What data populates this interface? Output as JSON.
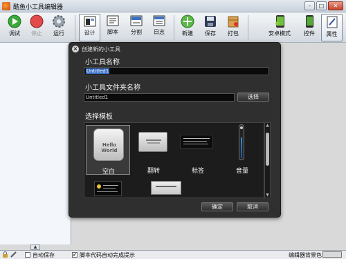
{
  "window": {
    "title": "酷鱼小工具编辑器"
  },
  "toolbar": {
    "items": [
      {
        "label": "调试",
        "icon": "play-icon"
      },
      {
        "label": "停止",
        "icon": "stop-icon"
      },
      {
        "label": "运行",
        "icon": "gear-icon"
      },
      {
        "label": "设计",
        "icon": "design-icon"
      },
      {
        "label": "脚本",
        "icon": "script-icon"
      },
      {
        "label": "分割",
        "icon": "split-icon"
      },
      {
        "label": "日志",
        "icon": "log-icon"
      },
      {
        "label": "新建",
        "icon": "new-icon"
      },
      {
        "label": "保存",
        "icon": "save-icon"
      },
      {
        "label": "打包",
        "icon": "package-icon"
      },
      {
        "label": "安卓模式",
        "icon": "android-icon"
      },
      {
        "label": "控件",
        "icon": "widgets-icon"
      },
      {
        "label": "属性",
        "icon": "properties-icon"
      }
    ],
    "selected": [
      "设计",
      "属性"
    ],
    "disabled": [
      "停止"
    ]
  },
  "dialog": {
    "title": "创建新的小工具",
    "name_label": "小工具名称",
    "name_value": "Untitled1",
    "folder_label": "小工具文件夹名称",
    "folder_value": "Untitled1",
    "browse_button": "选择",
    "template_label": "选择模板",
    "templates": [
      {
        "label": "空白",
        "preview_text": "Hello World"
      },
      {
        "label": "翻转"
      },
      {
        "label": "标签"
      },
      {
        "label": "音量"
      }
    ],
    "ok_button": "确定",
    "cancel_button": "取消"
  },
  "statusbar": {
    "auto_save": "自动保存",
    "auto_save_checked": false,
    "script_autocomplete": "脚本代码自动完成提示",
    "script_autocomplete_checked": true,
    "background_color_label": "编辑器背景色"
  },
  "colors": {
    "dialog_bg": "#2f2f2f",
    "selection_blue": "#3a6fc4",
    "workspace_bg": "#d9d9d9"
  }
}
